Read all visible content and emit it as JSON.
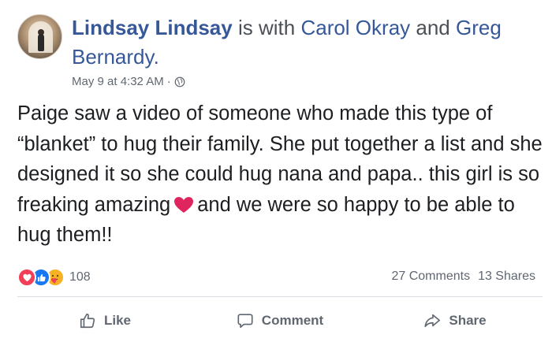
{
  "header": {
    "author": "Lindsay Lindsay",
    "is_with_text": "is with",
    "tagged_1": "Carol Okray",
    "and_text": "and",
    "tagged_2": "Greg Bernardy.",
    "timestamp": "May 9 at 4:32 AM",
    "separator": "·",
    "privacy_icon": "globe-icon"
  },
  "post": {
    "text_before_heart": "Paige saw a video of someone who made this type of “blanket” to hug their family. She put together a list and she designed it so she could hug nana and papa.. this girl is so freaking amazing",
    "heart_emoji": "red-heart-icon",
    "text_after_heart": "and we were so happy to be able to hug them!!"
  },
  "reactions": {
    "icons": [
      "love-icon",
      "like-icon",
      "care-icon"
    ],
    "count": "108"
  },
  "stats": {
    "comments": "27 Comments",
    "shares": "13 Shares"
  },
  "actions": {
    "like": "Like",
    "comment": "Comment",
    "share": "Share"
  },
  "colors": {
    "link": "#365899",
    "meta": "#606770",
    "love": "#f33e58",
    "like": "#1877f2",
    "care": "#f7b125"
  }
}
